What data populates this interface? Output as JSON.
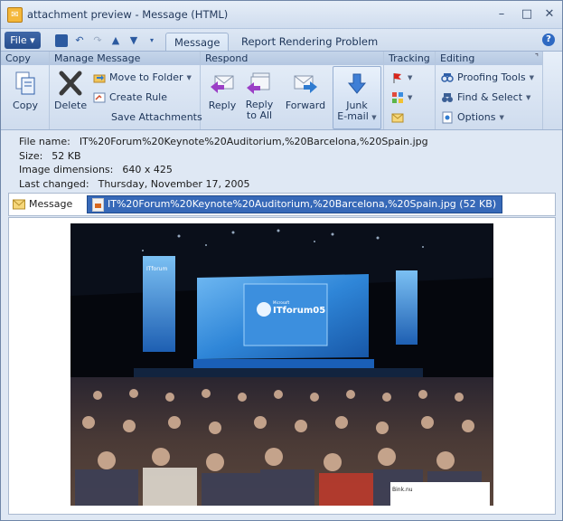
{
  "window": {
    "title": "attachment preview - Message (HTML)"
  },
  "tabs": {
    "file": "File",
    "message": "Message",
    "report": "Report Rendering Problem"
  },
  "ribbon": {
    "copy": {
      "label": "Copy",
      "button": "Copy"
    },
    "manage": {
      "label": "Manage Message",
      "delete": "Delete",
      "move_to_folder": "Move to Folder",
      "create_rule": "Create Rule",
      "save_attachments": "Save Attachments"
    },
    "respond": {
      "label": "Respond",
      "reply": "Reply",
      "reply_all_1": "Reply",
      "reply_all_2": "to All",
      "forward": "Forward",
      "junk_1": "Junk",
      "junk_2": "E-mail"
    },
    "tracking": {
      "label": "Tracking"
    },
    "editing": {
      "label": "Editing",
      "proofing": "Proofing Tools",
      "find_select": "Find & Select",
      "options": "Options"
    }
  },
  "file_info": {
    "name_label": "File name:",
    "name": "IT%20Forum%20Keynote%20Auditorium,%20Barcelona,%20Spain.jpg",
    "size_label": "Size:",
    "size": "52 KB",
    "dims_label": "Image dimensions:",
    "dims": "640 x 425",
    "changed_label": "Last changed:",
    "changed": "Thursday, November 17, 2005"
  },
  "attachments": {
    "message": "Message",
    "file": "IT%20Forum%20Keynote%20Auditorium,%20Barcelona,%20Spain.jpg (52 KB)"
  },
  "photo": {
    "screen_brand": "Microsoft",
    "screen_title": "ITforum05",
    "side_banner": "ITforum",
    "watermark": "Bink.nu"
  },
  "colors": {
    "accent": "#2a5aa6",
    "ribbon": "#dfe8f4",
    "selection": "#3769b8"
  }
}
